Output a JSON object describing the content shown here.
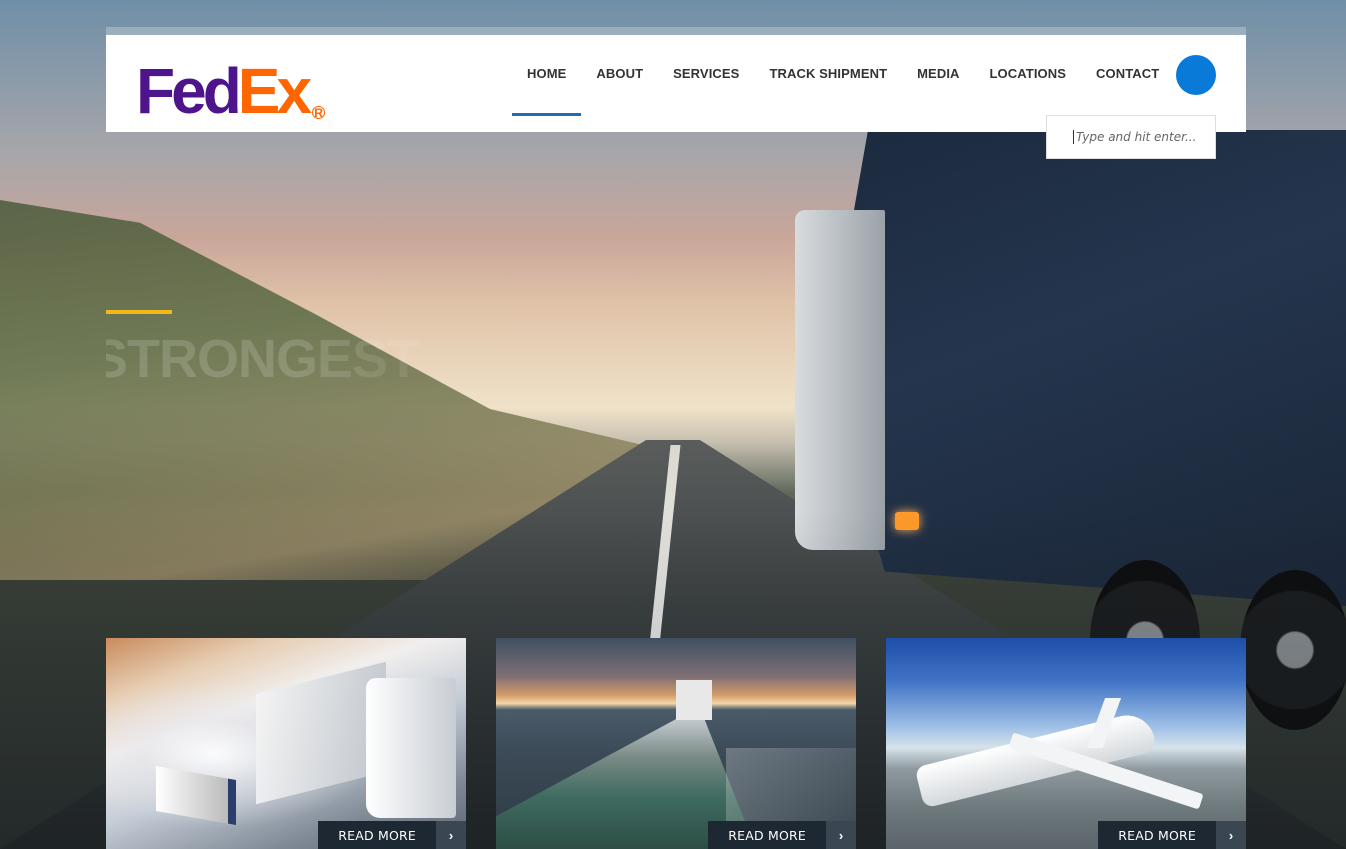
{
  "brand": {
    "logo_fed": "Fed",
    "logo_ex": "Ex",
    "logo_reg": "R"
  },
  "nav": {
    "items": [
      {
        "label": "HOME",
        "active": true
      },
      {
        "label": "ABOUT"
      },
      {
        "label": "SERVICES"
      },
      {
        "label": "TRACK SHIPMENT"
      },
      {
        "label": "MEDIA"
      },
      {
        "label": "LOCATIONS"
      },
      {
        "label": "CONTACT"
      }
    ]
  },
  "search": {
    "placeholder": "Type and hit enter..."
  },
  "hero": {
    "title": "STRONGEST"
  },
  "cards": [
    {
      "image": "truck-highway-image",
      "button": "READ MORE",
      "arrow": "›"
    },
    {
      "image": "cargo-ship-image",
      "button": "READ MORE",
      "arrow": "›"
    },
    {
      "image": "airplane-image",
      "button": "READ MORE",
      "arrow": "›"
    }
  ],
  "colors": {
    "fedex_purple": "#4d148c",
    "fedex_orange": "#ff6600",
    "accent_blue": "#0a7ad8",
    "accent_yellow": "#f2b81a"
  }
}
